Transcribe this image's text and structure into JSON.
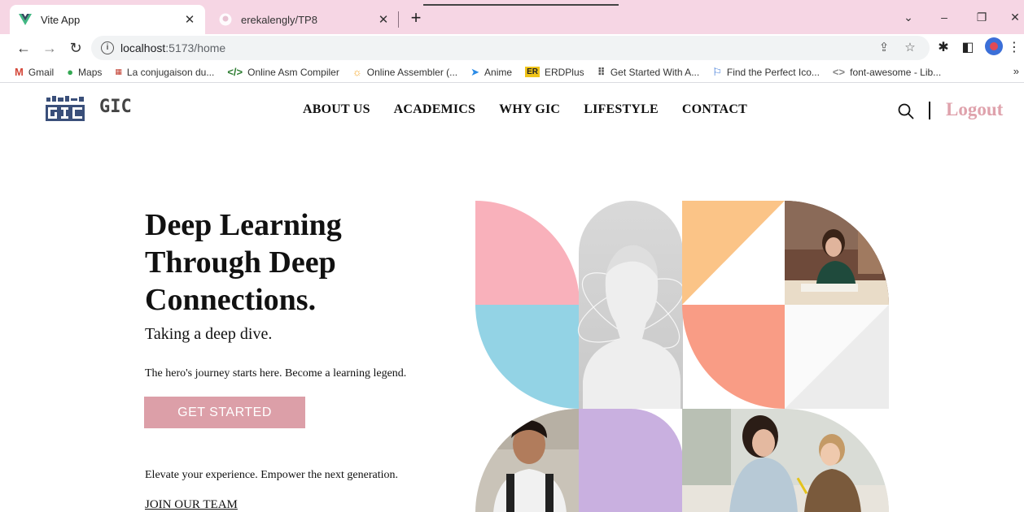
{
  "browser": {
    "tabs": [
      {
        "title": "Vite App",
        "active": true
      },
      {
        "title": "erekalengly/TP8",
        "active": false
      }
    ],
    "url_host": "localhost",
    "url_path": ":5173/home",
    "bookmarks": [
      {
        "label": "Gmail",
        "icon": "gmail-icon"
      },
      {
        "label": "Maps",
        "icon": "maps-pin-icon"
      },
      {
        "label": "La conjugaison du...",
        "icon": "conjugaison-icon"
      },
      {
        "label": "Online Asm Compiler",
        "icon": "code-brackets-icon"
      },
      {
        "label": "Online Assembler (...",
        "icon": "sun-icon"
      },
      {
        "label": "Anime",
        "icon": "paper-plane-icon"
      },
      {
        "label": "ERDPlus",
        "icon": "er-icon"
      },
      {
        "label": "Get Started With A...",
        "icon": "grid-dots-icon"
      },
      {
        "label": "Find the Perfect Ico...",
        "icon": "flag-icon"
      },
      {
        "label": "font-awesome - Lib...",
        "icon": "angle-brackets-icon"
      }
    ],
    "bookmarks_more": "»"
  },
  "site": {
    "brand": "GIC",
    "nav": [
      "ABOUT US",
      "ACADEMICS",
      "WHY GIC",
      "LIFESTYLE",
      "CONTACT"
    ],
    "logout": "Logout"
  },
  "hero": {
    "title": "Deep Learning Through Deep Connections.",
    "subtitle": "Taking a deep dive.",
    "body": "The hero's journey starts here. Become a learning legend.",
    "cta": "GET STARTED",
    "elevate": "Elevate your experience. Empower the next generation.",
    "join": "JOIN OUR TEAM"
  },
  "colors": {
    "tabbar": "#f6d6e4",
    "accent_pink": "#dc9fa8",
    "logout": "#dfa2ac",
    "tile_pink": "#f9b1bb",
    "tile_blue": "#93d3e5",
    "tile_orange": "#fbc487",
    "tile_salmon": "#f99c85",
    "tile_lilac": "#c9b0e0"
  }
}
